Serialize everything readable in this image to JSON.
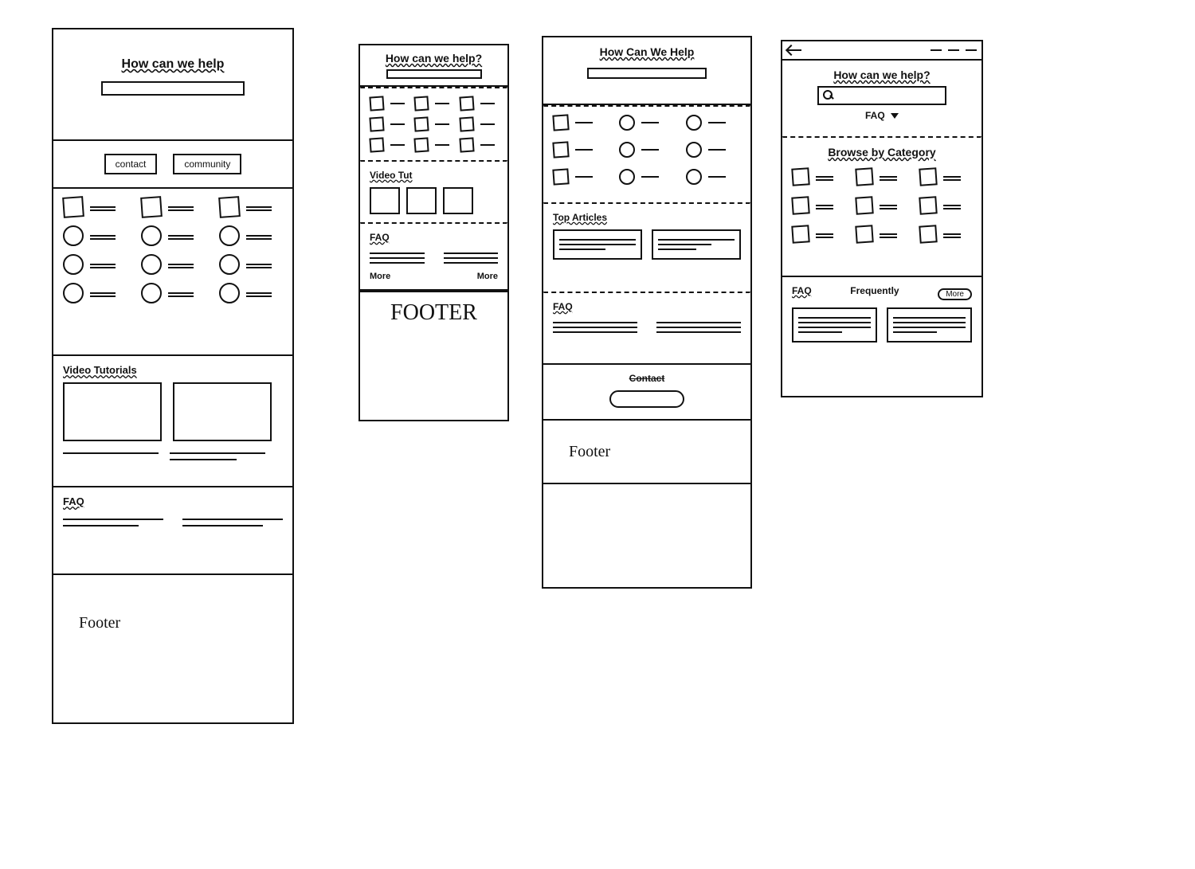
{
  "panel1": {
    "hero_title": "How can we help",
    "tabs": {
      "left": "contact",
      "right": "community"
    },
    "video_label": "Video Tutorials",
    "faq_label": "FAQ",
    "footer_label": "Footer"
  },
  "panel2": {
    "hero_title": "How can we help?",
    "video_label": "Video Tut",
    "faq_label": "FAQ",
    "more_label": "More",
    "footer_label": "FOOTER"
  },
  "panel3": {
    "hero_title": "How Can We Help",
    "articles_label": "Top Articles",
    "faq_label": "FAQ",
    "contact_label": "Contact",
    "footer_label": "Footer"
  },
  "panel4": {
    "hero_title": "How can we help?",
    "faq_badge": "FAQ",
    "browse_label": "Browse by Category",
    "faq_label": "FAQ",
    "frequently_label": "Frequently",
    "more_label": "More"
  }
}
